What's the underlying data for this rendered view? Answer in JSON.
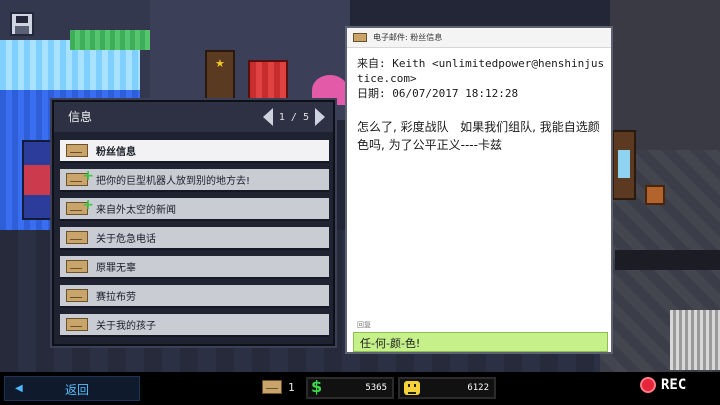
{
  "inbox": {
    "title": "信息",
    "page": "1 / 5",
    "items": [
      {
        "label": "粉丝信息",
        "selected": true,
        "unread": false
      },
      {
        "label": "把你的巨型机器人放到别的地方去!",
        "selected": false,
        "unread": true
      },
      {
        "label": "来自外太空的新闻",
        "selected": false,
        "unread": true
      },
      {
        "label": "关于危急电话",
        "selected": false,
        "unread": false
      },
      {
        "label": "原罪无辜",
        "selected": false,
        "unread": false
      },
      {
        "label": "赛拉布劳",
        "selected": false,
        "unread": false
      },
      {
        "label": "关于我的孩子",
        "selected": false,
        "unread": false
      }
    ]
  },
  "reader": {
    "subject": "电子邮件: 粉丝信息",
    "from": "来自: Keith <unlimitedpower@henshinjustice.com>",
    "date": "日期: 06/07/2017 18:12:28",
    "body": "怎么了, 彩度战队   如果我们组队, 我能自选颜色吗, 为了公平正义----卡兹",
    "reply_label": "回复",
    "reply_text": "任-何-颜-色!"
  },
  "bottom_bar": {
    "back_label": "返回",
    "mail_count": "1",
    "money": "5365",
    "fans": "6122",
    "rec_label": "REC"
  },
  "icons": {
    "save": "save-disk-icon",
    "envelope": "envelope-icon",
    "money": "dollar-icon",
    "fans": "smiley-icon",
    "record": "record-dot-icon"
  },
  "colors": {
    "reply_highlight": "#c6f08a",
    "money_green": "#3cd74a",
    "rec_red": "#e6243a",
    "back_blue": "#59c0ff"
  }
}
